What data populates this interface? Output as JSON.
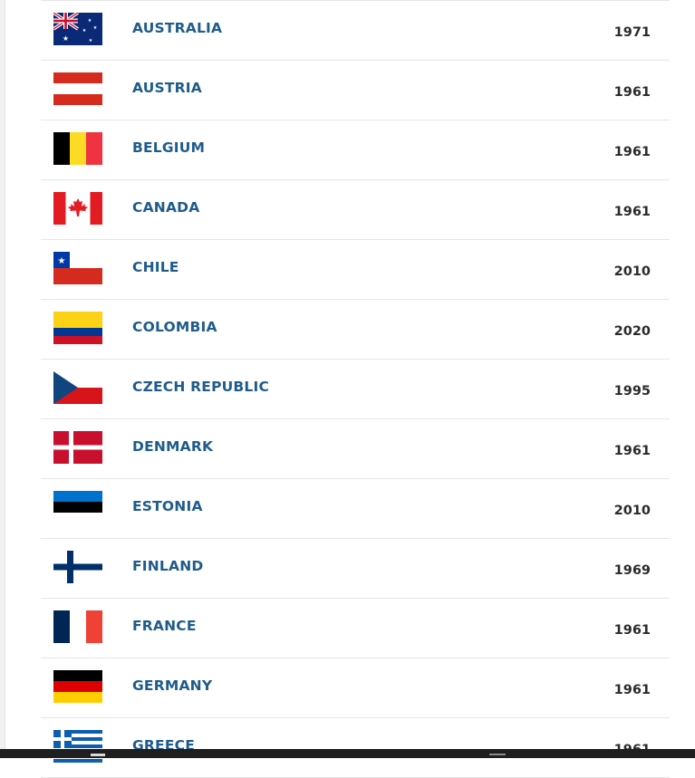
{
  "countries": [
    {
      "name": "AUSTRALIA",
      "year": "1971",
      "flag_icon": "australia-flag-icon"
    },
    {
      "name": "AUSTRIA",
      "year": "1961",
      "flag_icon": "austria-flag-icon"
    },
    {
      "name": "BELGIUM",
      "year": "1961",
      "flag_icon": "belgium-flag-icon"
    },
    {
      "name": "CANADA",
      "year": "1961",
      "flag_icon": "canada-flag-icon"
    },
    {
      "name": "CHILE",
      "year": "2010",
      "flag_icon": "chile-flag-icon"
    },
    {
      "name": "COLOMBIA",
      "year": "2020",
      "flag_icon": "colombia-flag-icon"
    },
    {
      "name": "CZECH REPUBLIC",
      "year": "1995",
      "flag_icon": "czech-republic-flag-icon"
    },
    {
      "name": "DENMARK",
      "year": "1961",
      "flag_icon": "denmark-flag-icon"
    },
    {
      "name": "ESTONIA",
      "year": "2010",
      "flag_icon": "estonia-flag-icon"
    },
    {
      "name": "FINLAND",
      "year": "1969",
      "flag_icon": "finland-flag-icon"
    },
    {
      "name": "FRANCE",
      "year": "1961",
      "flag_icon": "france-flag-icon"
    },
    {
      "name": "GERMANY",
      "year": "1961",
      "flag_icon": "germany-flag-icon"
    },
    {
      "name": "GREECE",
      "year": "1961",
      "flag_icon": "greece-flag-icon"
    }
  ],
  "colors": {
    "link": "#1f5c8b",
    "year_text": "#2b2b2b",
    "divider": "#e6e6e6"
  }
}
